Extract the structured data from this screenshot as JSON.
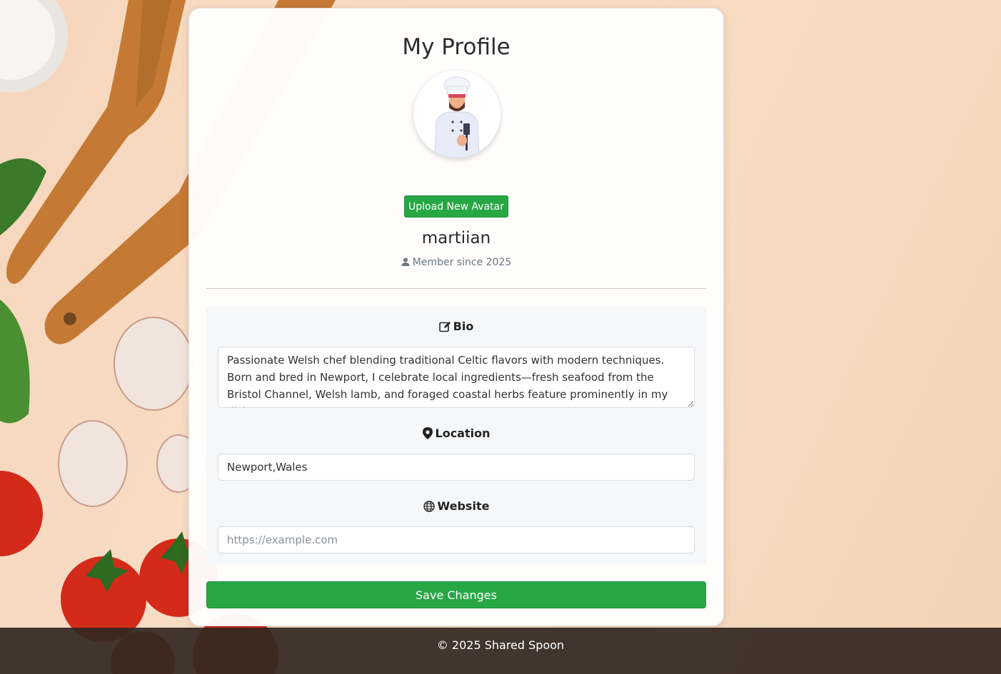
{
  "page": {
    "title": "My Profile",
    "upload_button": "Upload New Avatar",
    "username": "martiian",
    "member_since": "Member since 2025"
  },
  "form": {
    "bio": {
      "label": "Bio",
      "value": "Passionate Welsh chef blending traditional Celtic flavors with modern techniques. Born and bred in Newport, I celebrate local ingredients—fresh seafood from the Bristol Channel, Welsh lamb, and foraged coastal herbs feature prominently in my dishes."
    },
    "location": {
      "label": "Location",
      "value": "Newport,Wales"
    },
    "website": {
      "label": "Website",
      "value": "",
      "placeholder": "https://example.com"
    },
    "save_button": "Save Changes"
  },
  "footer": {
    "text": "© 2025 Shared Spoon"
  },
  "colors": {
    "primary_green": "#28a745",
    "footer_bg": "#342821"
  },
  "icons": [
    "user-icon",
    "edit-icon",
    "map-pin-icon",
    "globe-icon",
    "chef-avatar"
  ]
}
